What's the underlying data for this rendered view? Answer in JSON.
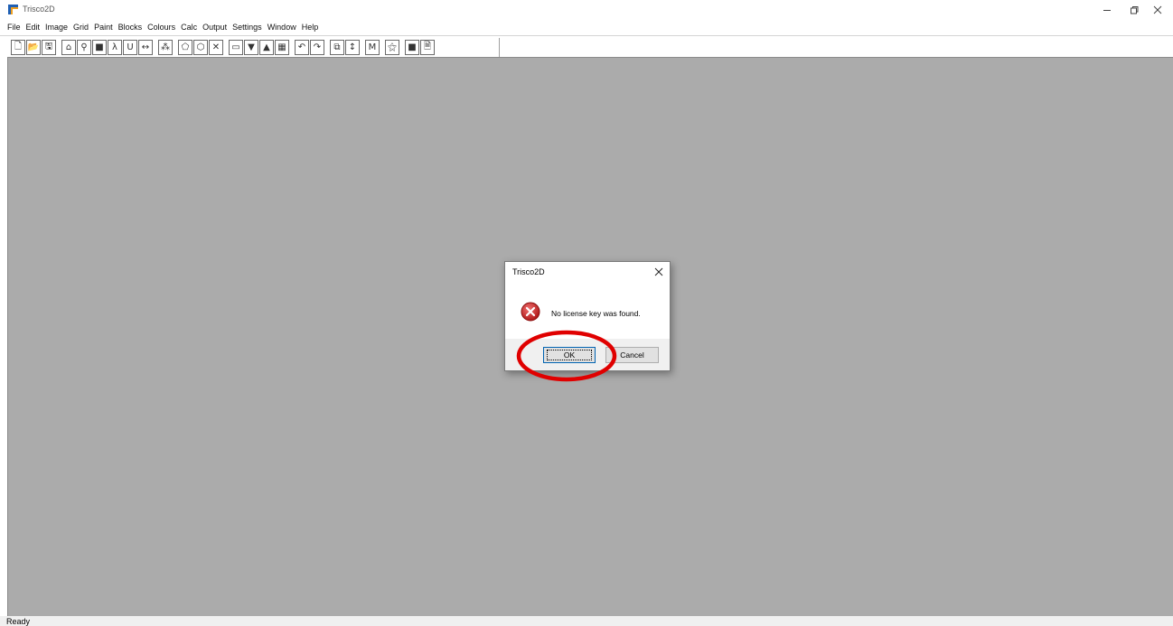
{
  "window": {
    "title": "Trisco2D",
    "controls": [
      "minimize",
      "restore",
      "close"
    ]
  },
  "menu": {
    "items": [
      "File",
      "Edit",
      "Image",
      "Grid",
      "Paint",
      "Blocks",
      "Colours",
      "Calc",
      "Output",
      "Settings",
      "Window",
      "Help"
    ]
  },
  "toolbar": {
    "buttons": [
      {
        "icon": "new-file-icon",
        "glyph": "🗋"
      },
      {
        "icon": "open-folder-icon",
        "glyph": "📂"
      },
      {
        "icon": "save-icon",
        "glyph": "🖫"
      },
      {
        "icon": "home-icon",
        "glyph": "⌂"
      },
      {
        "icon": "tree-icon",
        "glyph": "⚲"
      },
      {
        "icon": "block-icon",
        "glyph": "■"
      },
      {
        "icon": "lambda-icon",
        "glyph": "λ"
      },
      {
        "icon": "u-icon",
        "glyph": "U"
      },
      {
        "icon": "arrow-horizontal-icon",
        "glyph": "↔"
      },
      {
        "icon": "scatter-icon",
        "glyph": "⁂"
      },
      {
        "icon": "polygon-icon",
        "glyph": "⬠"
      },
      {
        "icon": "polygon-outline-icon",
        "glyph": "⬡"
      },
      {
        "icon": "cross-icon",
        "glyph": "✕"
      },
      {
        "icon": "panel-icon",
        "glyph": "▭"
      },
      {
        "icon": "down-panel-icon",
        "glyph": "▼"
      },
      {
        "icon": "up-panel-icon",
        "glyph": "▲"
      },
      {
        "icon": "grid-image-icon",
        "glyph": "▦"
      },
      {
        "icon": "undo-icon",
        "glyph": "↶"
      },
      {
        "icon": "redo-icon",
        "glyph": "↷"
      },
      {
        "icon": "copy-icon",
        "glyph": "⧉"
      },
      {
        "icon": "arrow-vertical-icon",
        "glyph": "↕"
      },
      {
        "icon": "m-icon",
        "glyph": "M"
      },
      {
        "icon": "wand-icon",
        "glyph": "⚝"
      },
      {
        "icon": "color-block-icon",
        "glyph": "■"
      },
      {
        "icon": "document-icon",
        "glyph": "🗎"
      }
    ]
  },
  "status": {
    "text": "Ready"
  },
  "dialog": {
    "title": "Trisco2D",
    "message": "No license key was found.",
    "icon": "error-icon",
    "ok_label": "OK",
    "cancel_label": "Cancel",
    "highlight_color": "#e00000"
  },
  "colors": {
    "workspace": "#ababab",
    "error_red": "#c82828",
    "focus_border": "#0063b1"
  }
}
